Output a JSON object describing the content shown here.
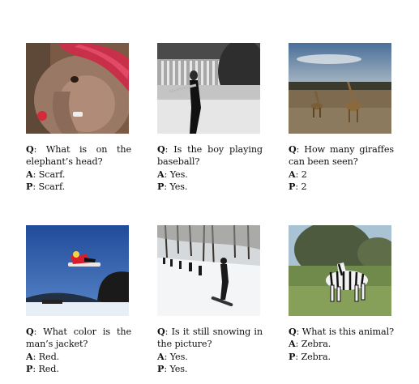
{
  "prefix": {
    "q": "Q",
    "a": "A",
    "p": "P",
    "sep": ": "
  },
  "items": [
    {
      "q": "What is on the elephant’s head?",
      "a": "Scarf.",
      "p": "Scarf.",
      "image": "elephant with red scarf"
    },
    {
      "q": "Is the boy playing baseball?",
      "a": "Yes.",
      "p": "Yes.",
      "image": "boy swinging baseball bat (black and white)"
    },
    {
      "q": "How many giraffes can been seen?",
      "a": "2",
      "p": "2",
      "image": "two giraffes in savanna"
    },
    {
      "q": "What color is the man’s jacket?",
      "a": "Red.",
      "p": "Red.",
      "image": "snowboarder jumping against blue sky"
    },
    {
      "q": "Is it still snowing in the picture?",
      "a": "Yes.",
      "p": "Yes.",
      "image": "snowboarders on snowy slope with trees"
    },
    {
      "q": "What is this animal?",
      "a": "Zebra.",
      "p": "Zebra.",
      "image": "zebra in grass field"
    }
  ]
}
